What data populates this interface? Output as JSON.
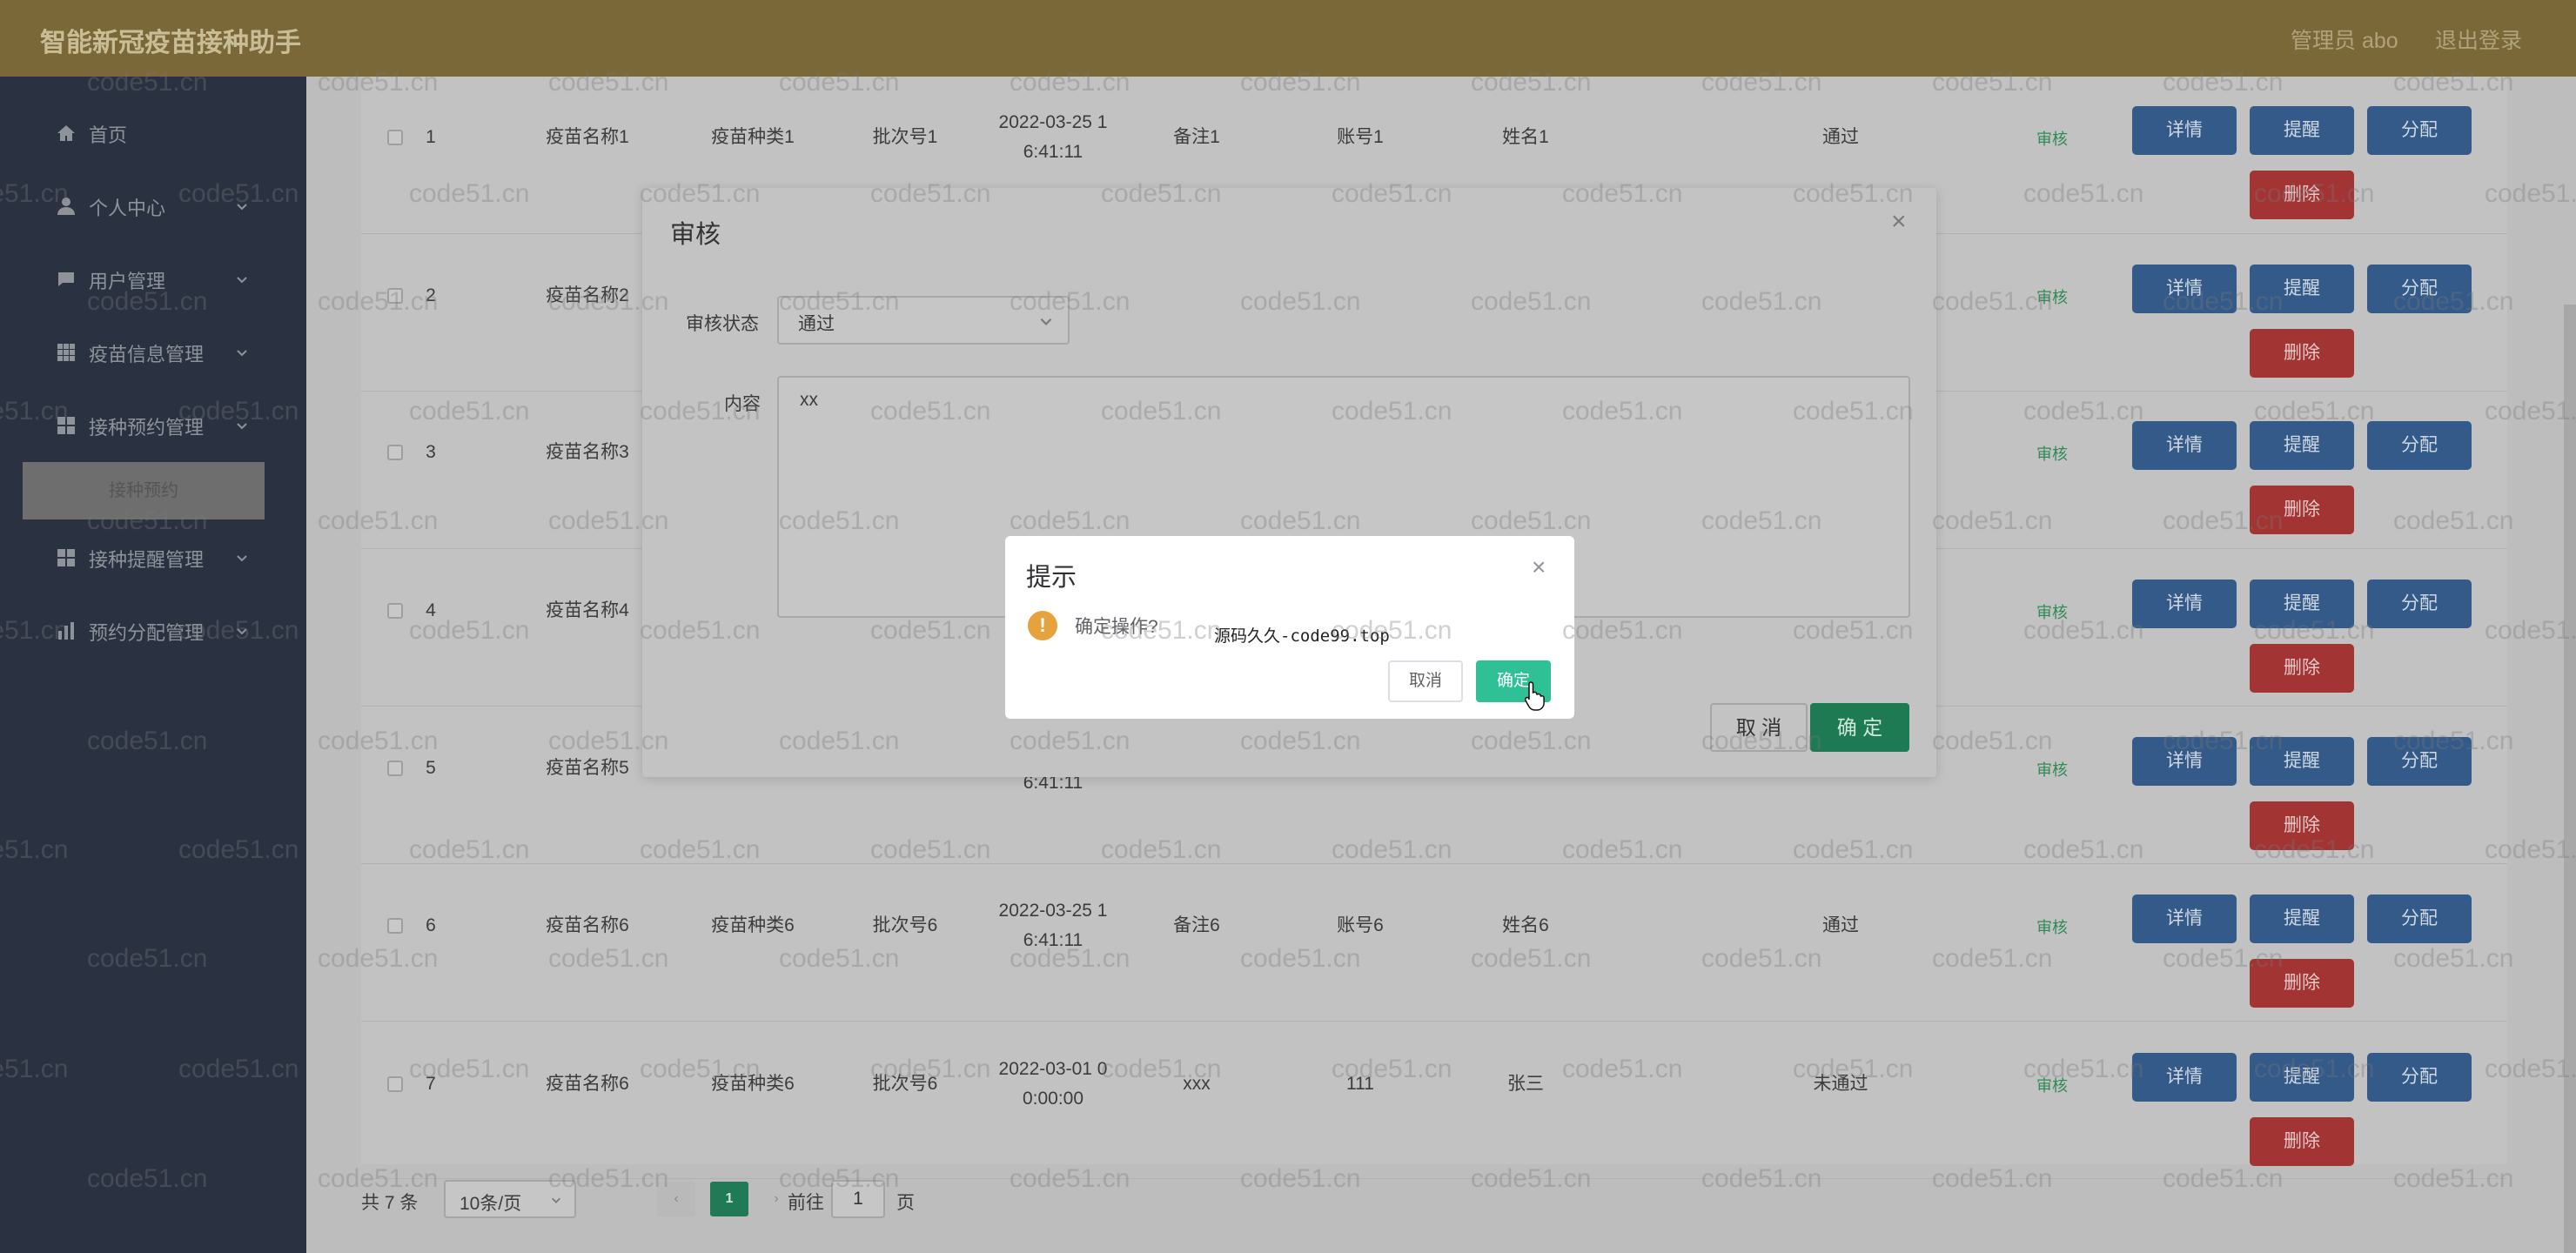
{
  "header": {
    "title": "智能新冠疫苗接种助手",
    "user": "管理员 abo",
    "logout": "退出登录"
  },
  "sidebar": {
    "items": [
      {
        "label": "首页",
        "icon": "home-icon"
      },
      {
        "label": "个人中心",
        "icon": "user-icon"
      },
      {
        "label": "用户管理",
        "icon": "chat-icon"
      },
      {
        "label": "疫苗信息管理",
        "icon": "grid-icon"
      },
      {
        "label": "接种预约管理",
        "icon": "grid-icon"
      },
      {
        "label": "接种提醒管理",
        "icon": "grid-icon"
      },
      {
        "label": "预约分配管理",
        "icon": "bar-chart-icon"
      }
    ],
    "sub_item": "接种预约"
  },
  "table": {
    "rows": [
      {
        "idx": "1",
        "name": "疫苗名称1",
        "type": "疫苗种类1",
        "batch": "批次号1",
        "time1": "2022-03-25 1",
        "time2": "6:41:11",
        "note": "备注1",
        "account": "账号1",
        "person": "姓名1",
        "status": "通过"
      },
      {
        "idx": "2",
        "name": "疫苗名称2",
        "type": "",
        "batch": "",
        "time1": "",
        "time2": "",
        "note": "",
        "account": "",
        "person": "",
        "status": ""
      },
      {
        "idx": "3",
        "name": "疫苗名称3",
        "type": "",
        "batch": "",
        "time1": "",
        "time2": "",
        "note": "",
        "account": "",
        "person": "",
        "status": ""
      },
      {
        "idx": "4",
        "name": "疫苗名称4",
        "type": "",
        "batch": "",
        "time1": "",
        "time2": "",
        "note": "",
        "account": "",
        "person": "",
        "status": ""
      },
      {
        "idx": "5",
        "name": "疫苗名称5",
        "type": "",
        "batch": "",
        "time1": "",
        "time2": "6:41:11",
        "note": "",
        "account": "",
        "person": "",
        "status": ""
      },
      {
        "idx": "6",
        "name": "疫苗名称6",
        "type": "疫苗种类6",
        "batch": "批次号6",
        "time1": "2022-03-25 1",
        "time2": "6:41:11",
        "note": "备注6",
        "account": "账号6",
        "person": "姓名6",
        "status": "通过"
      },
      {
        "idx": "7",
        "name": "疫苗名称6",
        "type": "疫苗种类6",
        "batch": "批次号6",
        "time1": "2022-03-01 0",
        "time2": "0:00:00",
        "note": "xxx",
        "account": "111",
        "person": "张三",
        "status": "未通过"
      }
    ],
    "audit_label": "审核",
    "btn_detail": "详情",
    "btn_remind": "提醒",
    "btn_assign": "分配",
    "btn_delete": "删除"
  },
  "pager": {
    "total": "共 7 条",
    "page_size": "10条/页",
    "current": "1",
    "goto_prefix": "前往",
    "goto_value": "1",
    "goto_suffix": "页"
  },
  "audit_dialog": {
    "title": "审核",
    "status_label": "审核状态",
    "status_value": "通过",
    "content_label": "内容",
    "content_value": "xx",
    "cancel": "取 消",
    "ok": "确 定"
  },
  "confirm_dialog": {
    "title": "提示",
    "message": "确定操作?",
    "source_text": "源码久久-code99.top",
    "cancel": "取消",
    "ok": "确定"
  },
  "watermark": "code51.cn"
}
